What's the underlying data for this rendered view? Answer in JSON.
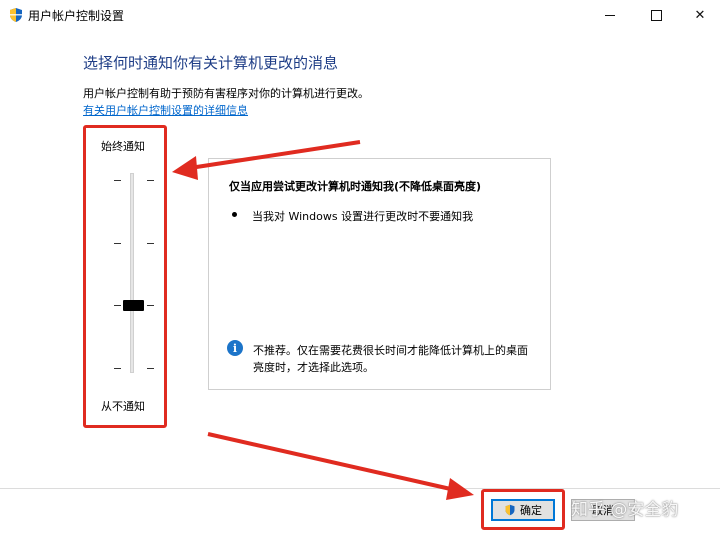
{
  "window": {
    "title": "用户帐户控制设置",
    "icon": "uac-shield-icon"
  },
  "main": {
    "heading": "选择何时通知你有关计算机更改的消息",
    "description": "用户帐户控制有助于预防有害程序对你的计算机进行更改。",
    "more_link": "有关用户帐户控制设置的详细信息"
  },
  "slider": {
    "label_top": "始终通知",
    "label_bottom": "从不通知",
    "levels": 4,
    "selected_level": 2
  },
  "panel": {
    "title": "仅当应用尝试更改计算机时通知我(不降低桌面亮度)",
    "bullet": "当我对 Windows 设置进行更改时不要通知我",
    "info": "不推荐。仅在需要花费很长时间才能降低计算机上的桌面亮度时，才选择此选项。"
  },
  "buttons": {
    "ok": "确定",
    "cancel": "取消"
  },
  "watermark": "知乎 @安全豹",
  "colors": {
    "heading": "#1e3d86",
    "link": "#0066cc",
    "annotation_red": "#e02b20",
    "info_blue": "#1c74c9",
    "focus_blue": "#0078d7"
  }
}
